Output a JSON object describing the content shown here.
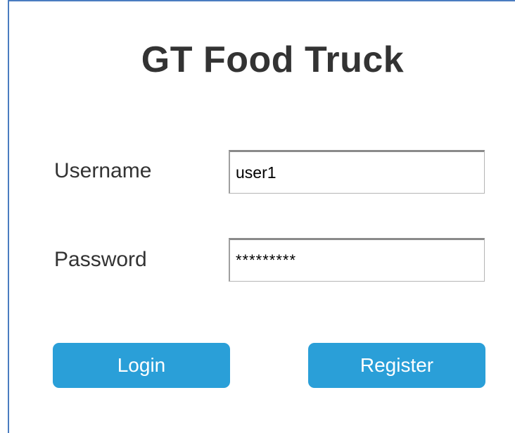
{
  "app": {
    "title": "GT Food Truck"
  },
  "form": {
    "username_label": "Username",
    "username_value": "user1",
    "password_label": "Password",
    "password_value": "*********"
  },
  "actions": {
    "login_label": "Login",
    "register_label": "Register"
  },
  "colors": {
    "accent": "#2a9fd8",
    "frame_border": "#4a7cc0",
    "text": "#333333"
  }
}
